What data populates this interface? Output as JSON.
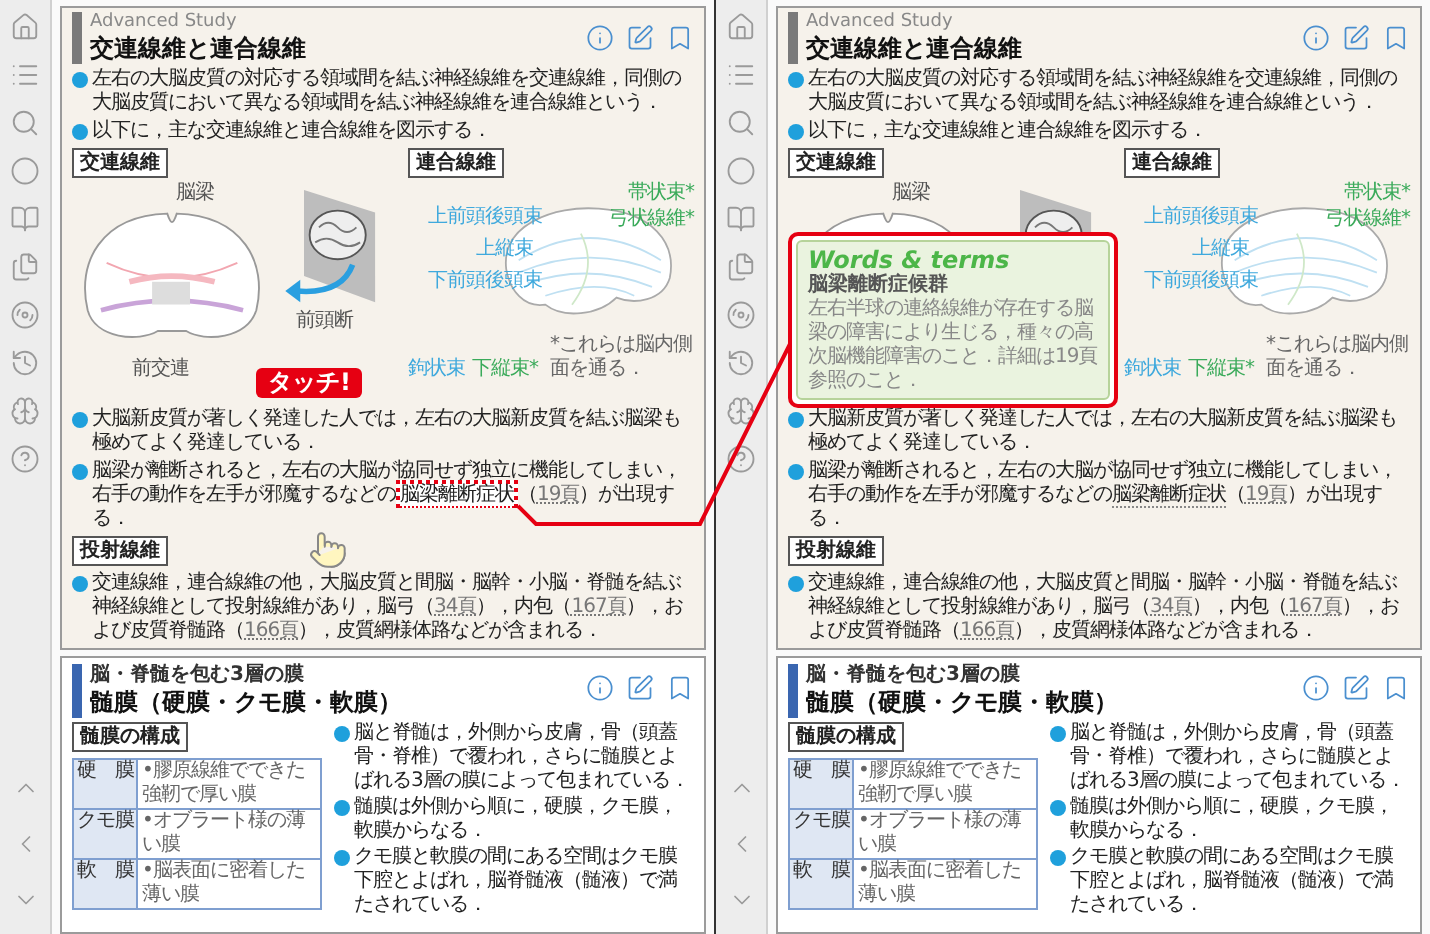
{
  "screens": [
    {
      "card1": {
        "eyebrow": "Advanced Study",
        "title": "交連線維と連合線維",
        "blocks": [
          {
            "kind": "bullet",
            "segments": [
              {
                "kind": "plain",
                "text": "左右の大脳皮質の対応する領域間を結ぶ神経線維を交連線維，同側の大脳皮質において異なる領域間を結ぶ神経線維を連合線維という．"
              }
            ]
          },
          {
            "kind": "bullet",
            "segments": [
              {
                "kind": "plain",
                "text": "以下に，主な交連線維と連合線維を図示する．"
              }
            ]
          },
          {
            "kind": "figures",
            "figures": [
              {
                "kind": "commissural",
                "label": "交連線維",
                "top_label": "脳梁",
                "bottom_label": "前交連",
                "section_label": "前頭断"
              },
              {
                "kind": "association",
                "label": "連合線維",
                "left_labels": [
                  {
                    "text": "上前頭後頭束",
                    "color": "#3fa9dd"
                  },
                  {
                    "text": "上縦束",
                    "color": "#3fa9dd"
                  },
                  {
                    "text": "下前頭後頭束",
                    "color": "#3fa9dd"
                  }
                ],
                "right_labels": [
                  {
                    "text": "帯状束*",
                    "color": "#3aaa5a"
                  },
                  {
                    "text": "弓状線維*",
                    "color": "#3aaa5a"
                  }
                ],
                "bottom_labels": [
                  {
                    "text": "鉤状束",
                    "color": "#3fa9dd"
                  },
                  {
                    "text": "下縦束*",
                    "color": "#3aaa5a"
                  }
                ],
                "note": "*これらは脳内側面を通る．"
              }
            ]
          },
          {
            "kind": "bullet",
            "segments": [
              {
                "kind": "plain",
                "text": "大脳新皮質が著しく発達した人では，左右の大脳新皮質を結ぶ脳梁も極めてよく発達している．"
              }
            ]
          },
          {
            "kind": "bullet",
            "segments": [
              {
                "kind": "plain",
                "text": "脳梁が離断されると，左右の大脳が協同せず独立に機能してしまい，右手の動作を左手が邪魔するなどの"
              },
              {
                "kind": "term",
                "text": "脳梁離断症状",
                "highlighted": true
              },
              {
                "kind": "plain",
                "text": "（"
              },
              {
                "kind": "ref",
                "text": "19頁"
              },
              {
                "kind": "plain",
                "text": "）が出現する．"
              }
            ]
          },
          {
            "kind": "section_label",
            "text": "投射線維"
          },
          {
            "kind": "bullet",
            "segments": [
              {
                "kind": "plain",
                "text": "交連線維，連合線維の他，大脳皮質と間脳・脳幹・小脳・脊髄を結ぶ神経線維として投射線維があり，脳弓（"
              },
              {
                "kind": "ref",
                "text": "34頁"
              },
              {
                "kind": "plain",
                "text": "），内包（"
              },
              {
                "kind": "ref",
                "text": "167頁"
              },
              {
                "kind": "plain",
                "text": "），および皮質脊髄路（"
              },
              {
                "kind": "ref",
                "text": "166頁"
              },
              {
                "kind": "plain",
                "text": "），皮質網様体路などが含まれる．"
              }
            ]
          }
        ]
      },
      "card2": {
        "eyebrow": "脳・脊髄を包む3層の膜",
        "title": "髄膜（硬膜・クモ膜・軟膜）",
        "table_label": "髄膜の構成",
        "table_rows": [
          {
            "name": "硬　膜",
            "note": "•膠原線維でできた強靭で厚い膜"
          },
          {
            "name": "クモ膜",
            "note": "•オブラート様の薄い膜"
          },
          {
            "name": "軟　膜",
            "note": "•脳表面に密着した薄い膜"
          }
        ],
        "bullets": [
          "脳と脊髄は，外側から皮膚，骨（頭蓋骨・脊椎）で覆われ，さらに髄膜とよばれる3層の膜によって包まれている．",
          "髄膜は外側から順に，硬膜，クモ膜，軟膜からなる．",
          "クモ膜と軟膜の間にある空間はクモ膜下腔とよばれ，脳脊髄液（髄液）で満たされている．"
        ]
      },
      "callout": {
        "text": "タッチ!"
      }
    },
    {
      "card1": {
        "eyebrow": "Advanced Study",
        "title": "交連線維と連合線維",
        "blocks": [
          {
            "kind": "bullet",
            "segments": [
              {
                "kind": "plain",
                "text": "左右の大脳皮質の対応する領域間を結ぶ神経線維を交連線維，同側の大脳皮質において異なる領域間を結ぶ神経線維を連合線維という．"
              }
            ]
          },
          {
            "kind": "bullet",
            "segments": [
              {
                "kind": "plain",
                "text": "以下に，主な交連線維と連合線維を図示する．"
              }
            ]
          },
          {
            "kind": "figures",
            "figures": [
              {
                "kind": "commissural",
                "label": "交連線維",
                "top_label": "脳梁"
              },
              {
                "kind": "association",
                "label": "連合線維",
                "left_labels": [
                  {
                    "text": "上前頭後頭束",
                    "color": "#3fa9dd"
                  },
                  {
                    "text": "上縦束",
                    "color": "#3fa9dd"
                  },
                  {
                    "text": "下前頭後頭束",
                    "color": "#3fa9dd"
                  }
                ],
                "right_labels": [
                  {
                    "text": "帯状束*",
                    "color": "#3aaa5a"
                  },
                  {
                    "text": "弓状線維*",
                    "color": "#3aaa5a"
                  }
                ],
                "bottom_labels": [
                  {
                    "text": "鉤状束",
                    "color": "#3fa9dd"
                  },
                  {
                    "text": "下縦束*",
                    "color": "#3aaa5a"
                  }
                ],
                "note": "*これらは脳内側面を通る．"
              }
            ]
          },
          {
            "kind": "bullet",
            "segments": [
              {
                "kind": "plain",
                "text": "大脳新皮質が著しく発達した人では，左右の大脳新皮質を結ぶ脳梁も極めてよく発達している．"
              }
            ]
          },
          {
            "kind": "bullet",
            "segments": [
              {
                "kind": "plain",
                "text": "脳梁が離断されると，左右の大脳が協同せず独立に機能してしまい，右手の動作を左手が邪魔するなどの"
              },
              {
                "kind": "term",
                "text": "脳梁離断症状",
                "highlighted": false
              },
              {
                "kind": "plain",
                "text": "（"
              },
              {
                "kind": "ref",
                "text": "19頁"
              },
              {
                "kind": "plain",
                "text": "）が出現する．"
              }
            ]
          },
          {
            "kind": "section_label",
            "text": "投射線維"
          },
          {
            "kind": "bullet",
            "segments": [
              {
                "kind": "plain",
                "text": "交連線維，連合線維の他，大脳皮質と間脳・脳幹・小脳・脊髄を結ぶ神経線維として投射線維があり，脳弓（"
              },
              {
                "kind": "ref",
                "text": "34頁"
              },
              {
                "kind": "plain",
                "text": "），内包（"
              },
              {
                "kind": "ref",
                "text": "167頁"
              },
              {
                "kind": "plain",
                "text": "），および皮質脊髄路（"
              },
              {
                "kind": "ref",
                "text": "166頁"
              },
              {
                "kind": "plain",
                "text": "），皮質網様体路などが含まれる．"
              }
            ]
          }
        ]
      },
      "card2": {
        "eyebrow": "脳・脊髄を包む3層の膜",
        "title": "髄膜（硬膜・クモ膜・軟膜）",
        "table_label": "髄膜の構成",
        "table_rows": [
          {
            "name": "硬　膜",
            "note": "•膠原線維でできた強靭で厚い膜"
          },
          {
            "name": "クモ膜",
            "note": "•オブラート様の薄い膜"
          },
          {
            "name": "軟　膜",
            "note": "•脳表面に密着した薄い膜"
          }
        ],
        "bullets": [
          "脳と脊髄は，外側から皮膚，骨（頭蓋骨・脊椎）で覆われ，さらに髄膜とよばれる3層の膜によって包まれている．",
          "髄膜は外側から順に，硬膜，クモ膜，軟膜からなる．",
          "クモ膜と軟膜の間にある空間はクモ膜下腔とよばれ，脳脊髄液（髄液）で満たされている．"
        ]
      },
      "popup": {
        "logo": "Words & terms",
        "term": "脳梁離断症候群",
        "body": "左右半球の連絡線維が存在する脳梁の障害により生じる，種々の高次脳機能障害のこと．詳細は19頁参照のこと．"
      }
    }
  ]
}
